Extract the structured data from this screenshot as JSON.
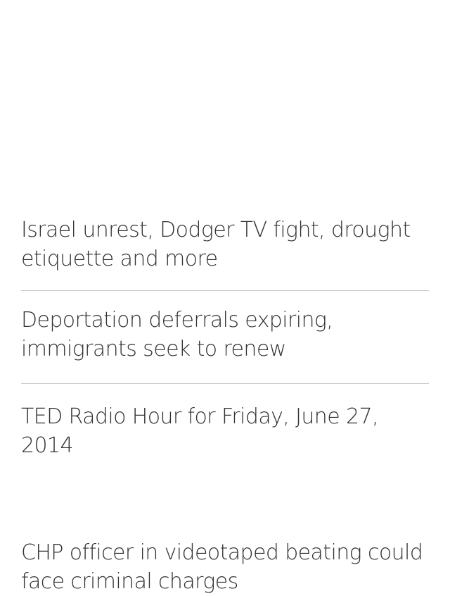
{
  "stories": [
    {
      "headline": "Israel unrest, Dodger TV fight, drought etiquette and more"
    },
    {
      "headline": "Deportation deferrals expiring, immigrants seek to renew"
    },
    {
      "headline": "TED Radio Hour for Friday, June 27, 2014"
    },
    {
      "headline": "CHP officer in videotaped beating could face criminal charges"
    }
  ]
}
